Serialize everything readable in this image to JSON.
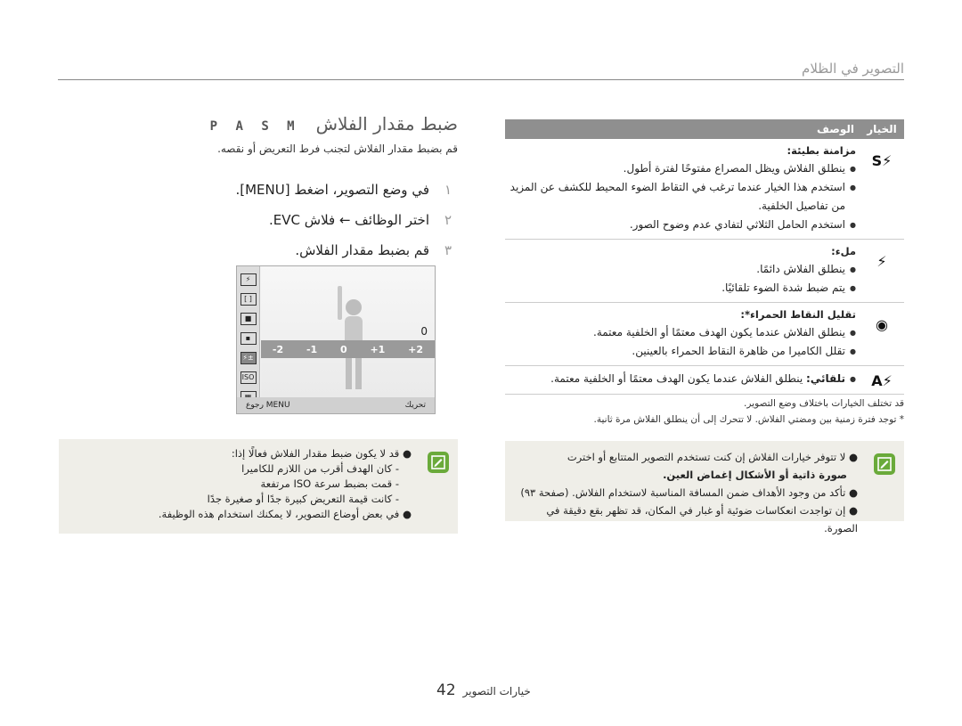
{
  "header": {
    "title": "التصوير في الظلام"
  },
  "right_table": {
    "col_option": "الخيار",
    "col_desc": "الوصف",
    "rows": [
      {
        "icon": "flash-slow-sync-icon",
        "glyph": "⚡S",
        "subtitle": "مزامنة بطيئة:",
        "bullets": [
          "ينطلق الفلاش ويظل المصراع مفتوحًا لفترة أطول.",
          "استخدم هذا الخيار عندما ترغب في التقاط الضوء المحيط للكشف عن المزيد من تفاصيل الخلفية.",
          "استخدم الحامل الثلاثي لتفادي عدم وضوح الصور."
        ]
      },
      {
        "icon": "flash-on-icon",
        "glyph": "⚡",
        "subtitle": "ملء:",
        "bullets": [
          "ينطلق الفلاش دائمًا.",
          "يتم ضبط شدة الضوء تلقائيًا."
        ]
      },
      {
        "icon": "red-eye-icon",
        "glyph": "◉",
        "subtitle": "تقليل النقاط الحمراء*:",
        "bullets": [
          "ينطلق الفلاش عندما يكون الهدف معتمًا أو الخلفية معتمة.",
          "تقلل الكاميرا من ظاهرة النقاط الحمراء بالعينين."
        ]
      },
      {
        "icon": "flash-auto-icon",
        "glyph": "⚡A",
        "inline_bold": "تلقائي:",
        "inline_text": "ينطلق الفلاش عندما يكون الهدف معتمًا أو الخلفية معتمة."
      }
    ]
  },
  "right_notes": [
    "قد تختلف الخيارات باختلاف وضع التصوير.",
    "* توجد فترة زمنية بين ومضتي الفلاش. لا تتحرك إلى أن ينطلق الفلاش مرة ثانية."
  ],
  "right_box": {
    "line1": "لا تتوفر خيارات الفلاش إن كنت تستخدم التصوير المتتابع أو اخترت",
    "sub": "صورة ذاتية أو الأشكال إغماض العين.",
    "bullets": [
      "تأكد من وجود الأهداف ضمن المسافة المناسبة لاستخدام الفلاش. (صفحة ٩٣)",
      "إن تواجدت انعكاسات ضوئية أو غبار في المكان، قد تظهر بقع دقيقة في الصورة."
    ]
  },
  "left": {
    "title": "ضبط مقدار الفلاش",
    "modes": "P A S M",
    "desc": "قم بضبط مقدار الفلاش لتجنب فرط التعريض أو نقصه.",
    "steps": [
      {
        "num": "١",
        "text": "في وضع التصوير، اضغط [MENU]."
      },
      {
        "num": "٢",
        "text": "اختر الوظائف ← فلاش EVC."
      },
      {
        "num": "٣",
        "text": "قم بضبط مقدار الفلاش."
      }
    ]
  },
  "camera": {
    "scale": [
      "-2",
      "-1",
      "0",
      "+1",
      "+2"
    ],
    "value": "0",
    "back_label": "MENU رجوع",
    "move_label": "تحريك"
  },
  "left_box": {
    "bullet1": "قد لا يكون ضبط مقدار الفلاش فعالًا إذا:",
    "dashes": [
      "كان الهدف أقرب من اللازم للكاميرا",
      "قمت بضبط سرعة ISO مرتفعة",
      "كانت قيمة التعريض كبيرة جدًا أو صغيرة جدًا"
    ],
    "bullet2": "في بعض أوضاع التصوير، لا يمكنك استخدام هذه الوظيفة."
  },
  "footer": {
    "page": "42",
    "label": "خيارات التصوير"
  }
}
